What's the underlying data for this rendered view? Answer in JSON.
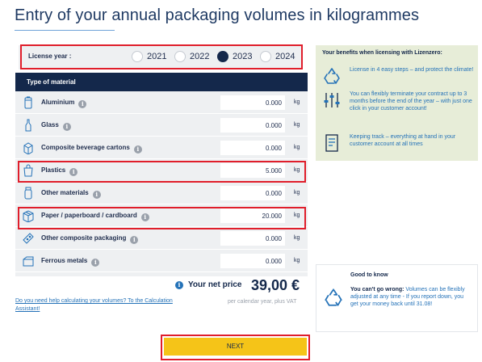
{
  "header": {
    "title": "Entry of your annual packaging volumes in kilogrammes"
  },
  "license": {
    "label": "License year :",
    "years": [
      "2021",
      "2022",
      "2023",
      "2024"
    ],
    "selected": "2023"
  },
  "table": {
    "header": "Type of material",
    "unit": "kg",
    "rows": [
      {
        "name": "Aluminium",
        "value": "0.000",
        "icon": "can-icon"
      },
      {
        "name": "Glass",
        "value": "0.000",
        "icon": "bottle-icon"
      },
      {
        "name": "Composite beverage cartons",
        "value": "0.000",
        "icon": "carton-icon"
      },
      {
        "name": "Plastics",
        "value": "5.000",
        "icon": "plastic-bag-icon"
      },
      {
        "name": "Other materials",
        "value": "0.000",
        "icon": "jar-icon"
      },
      {
        "name": "Paper / paperboard / cardboard",
        "value": "20.000",
        "icon": "box-icon"
      },
      {
        "name": "Other composite packaging",
        "value": "0.000",
        "icon": "blister-pack-icon"
      },
      {
        "name": "Ferrous metals",
        "value": "0.000",
        "icon": "tin-can-icon"
      }
    ]
  },
  "price": {
    "label": "Your net price",
    "value": "39,00 €",
    "note": "per calendar year, plus VAT"
  },
  "help_link": "Do you need help calculating your volumes? To the Calculation Assistant!",
  "next_button": "NEXT",
  "benefits": {
    "title": "Your benefits when licensing with Lizenzero:",
    "items": [
      {
        "icon": "recycle-icon",
        "text": "License in 4 easy steps – and protect the climate!"
      },
      {
        "icon": "sliders-icon",
        "text": "You can flexibly terminate your contract up to 3 months before the end of the year – with just one click in your customer account!"
      },
      {
        "icon": "document-icon",
        "text": "Keeping track – everything at hand in your customer account at all times"
      }
    ]
  },
  "good_to_know": {
    "title": "Good to know",
    "bold": "You can't go wrong:",
    "text": " Volumes can be flexibly adjusted at any time - If you report down, you get your money back until 31.08!"
  },
  "colors": {
    "navy": "#14284b",
    "accent_blue": "#2472b8",
    "yellow": "#f5c418",
    "highlight_red": "#e01e2b",
    "benefit_bg": "#e7edd8"
  }
}
